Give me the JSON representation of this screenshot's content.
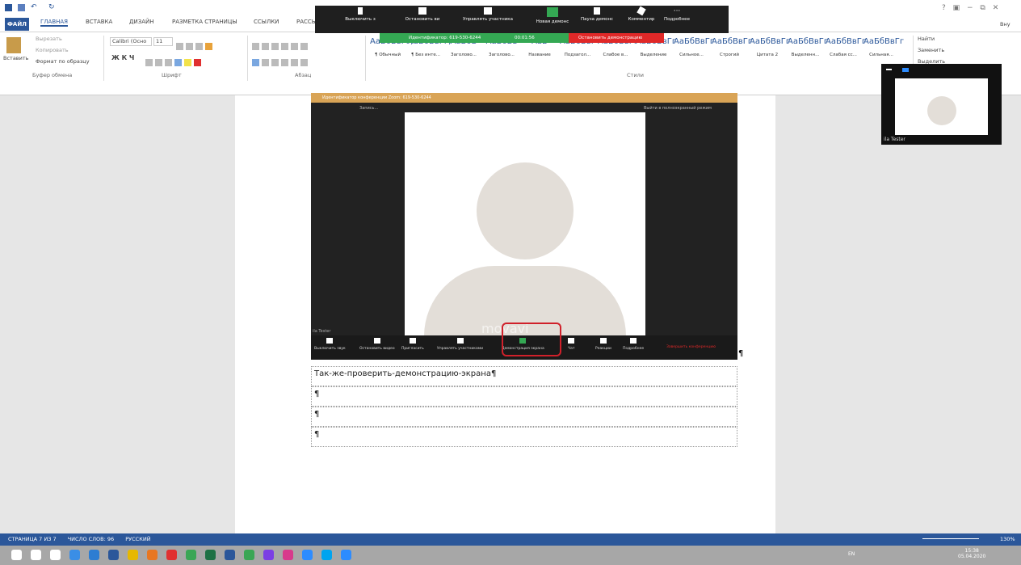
{
  "window": {
    "controls": "? ▣ − ⧉ ✕",
    "user": "Вну"
  },
  "tabs": [
    "ФАЙЛ",
    "ГЛАВНАЯ",
    "ВСТАВКА",
    "ДИЗАЙН",
    "РАЗМЕТКА СТРАНИЦЫ",
    "ССЫЛКИ",
    "РАССЫ"
  ],
  "clipboard": {
    "paste": "Вставить",
    "cut": "Вырезать",
    "copy": "Копировать",
    "format": "Формат по образцу",
    "label": "Буфер обмена"
  },
  "font": {
    "name": "Calibri (Осно",
    "size": "11",
    "label": "Шрифт"
  },
  "paragraph": {
    "label": "Абзац"
  },
  "styles": {
    "label": "Стили",
    "items": [
      {
        "sample": "АаБбВвГг,",
        "name": "¶ Обычный"
      },
      {
        "sample": "АаБбВвГг,",
        "name": "¶ Без инте..."
      },
      {
        "sample": "АаБбВ",
        "name": "Заголово..."
      },
      {
        "sample": "АаБбВв",
        "name": "Заголово..."
      },
      {
        "sample": "АаБ",
        "name": "Название"
      },
      {
        "sample": "АаБбВвГ",
        "name": "Подзагол..."
      },
      {
        "sample": "АаБбВвГг",
        "name": "Слабое в..."
      },
      {
        "sample": "АаБбВвГг",
        "name": "Выделение"
      },
      {
        "sample": "АаБбВвГг",
        "name": "Сильное..."
      },
      {
        "sample": "АаБбВвГг",
        "name": "Строгий"
      },
      {
        "sample": "АаБбВвГг",
        "name": "Цитата 2"
      },
      {
        "sample": "АаБбВвГг",
        "name": "Выделенн..."
      },
      {
        "sample": "АаБбВвГг",
        "name": "Слабая сс..."
      },
      {
        "sample": "АаБбВвГг",
        "name": "Сильная..."
      }
    ]
  },
  "editing": {
    "find": "Найти",
    "replace": "Заменить",
    "select": "Выделить"
  },
  "zoom_toolbar": [
    "Выключить з",
    "Остановить ви",
    "Управлять участника",
    "Новая демонс",
    "Пауза демонс",
    "Комментир",
    "Подробнее"
  ],
  "share_bar": {
    "id": "Идентификатор: 619-530-6244",
    "timer": "00:01:56",
    "stop": "Остановить демонстрацию"
  },
  "zoom_window": {
    "title": "Идентификатор конференции Zoom: 619-530-6244",
    "recording": "Запись...",
    "fullscreen": "Выйти в полноэкранный режим",
    "name": "ila Tester",
    "watermark": "movavi",
    "controls": [
      "Выключить звук",
      "Остановить видео",
      "Пригласить",
      "Управлять участниками",
      "Демонстрация экрана",
      "Чат",
      "Реакции",
      "Подробнее"
    ],
    "end": "Завершить конференцию"
  },
  "doc_lines": [
    "Так-же-проверить-демонстрацию-экрана¶",
    "¶",
    "¶",
    "¶"
  ],
  "pip": {
    "name": "ila Tester"
  },
  "statusbar": {
    "page": "СТРАНИЦА 7 ИЗ 7",
    "words": "ЧИСЛО СЛОВ: 96",
    "lang": "РУССКИЙ",
    "zoom": "130%"
  },
  "taskbar": {
    "lang": "EN",
    "time": "15:38",
    "date": "05.04.2020"
  },
  "colors": {
    "word": "#2b579a",
    "zoom_green": "#34a853",
    "zoom_red": "#e02828"
  }
}
